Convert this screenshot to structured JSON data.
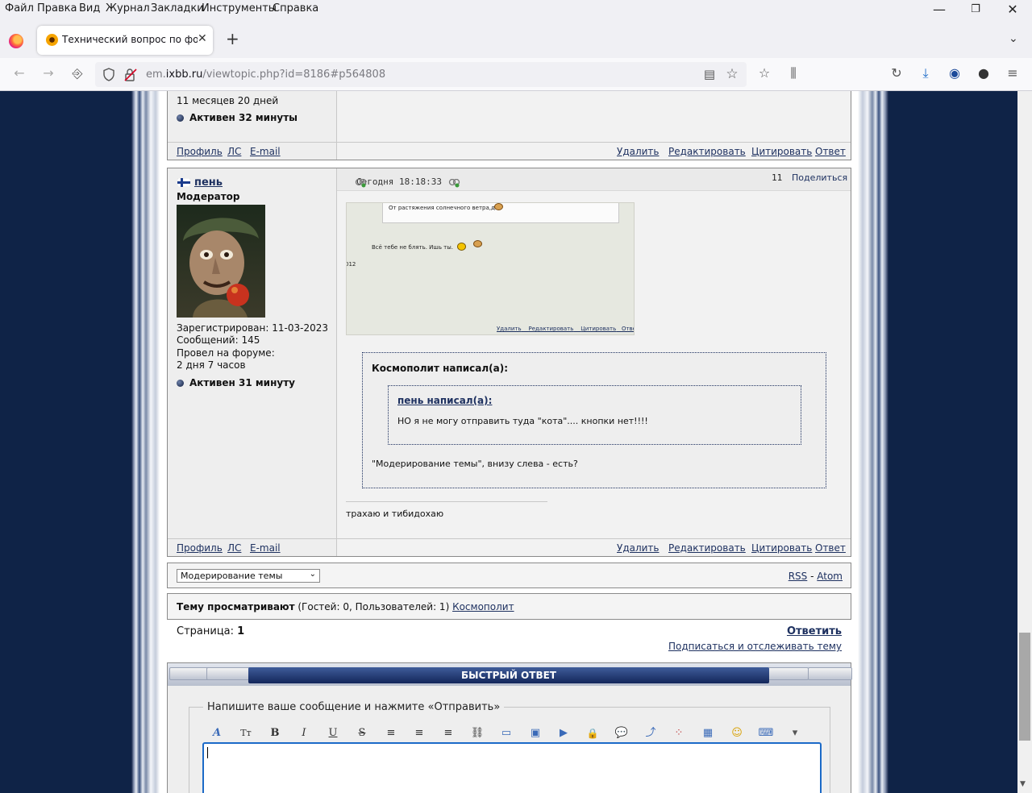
{
  "menubar": {
    "items": [
      "Файл",
      "Правка",
      "Вид",
      "Журнал",
      "Закладки",
      "Инструменты",
      "Справка"
    ],
    "minimize": "—",
    "restore": "❐",
    "close": "✕"
  },
  "tab": {
    "title": "Технический вопрос по форуму",
    "close": "✕",
    "new_tab": "+",
    "list": "⌄"
  },
  "nav": {
    "back": "←",
    "forward": "→",
    "import": "⎆",
    "url_prefix": "em.",
    "url_domain": "ixbb.ru",
    "url_path": "/viewtopic.php?id=8186#p564808",
    "reader": "▤",
    "star": "☆",
    "icons": [
      "☆",
      "⫼",
      "↻",
      "⤓",
      "◉",
      "●",
      "≡"
    ]
  },
  "prev_post": {
    "time_on_forum": "11 месяцев 20 дней",
    "active": "Активен 32 минуты",
    "links_left": [
      "Профиль",
      "ЛС",
      "E-mail"
    ],
    "links_right": [
      "Удалить",
      "Редактировать",
      "Цитировать",
      "Ответ"
    ]
  },
  "post": {
    "author": "пень",
    "role": "Модератор",
    "time": "Сегодня 18:18:33",
    "number": "11",
    "share": "Поделиться",
    "registered": "Зарегистрирован: 11-03-2023",
    "messages": "Сообщений: 145",
    "time_on_forum_label": "Провел на форуме:",
    "time_on_forum": "2 дня 7 часов",
    "active": "Активен 31 минуту",
    "screenshot": {
      "line1": "От растяжения солнечного ветра,да",
      "line2": "Всё тебе не  блять.  Ишь ты.",
      "side_num": "012",
      "links": [
        "Удалить",
        "Редактировать",
        "Цитировать",
        "Ответ"
      ]
    },
    "quote_outer": {
      "author_line": "Космополит написал(а):",
      "inner_author": "пень написал(а):",
      "inner_text": "НО я не могу отправить туда \"кота\".... кнопки нет!!!!",
      "text": "\"Модерирование темы\", внизу слева - есть?"
    },
    "signature": "трахаю и тибидохаю",
    "links_left": [
      "Профиль",
      "ЛС",
      "E-mail"
    ],
    "links_right": [
      "Удалить",
      "Редактировать",
      "Цитировать",
      "Ответ"
    ]
  },
  "moderation": {
    "select_value": "Модерирование темы",
    "rss": "RSS",
    "dash": " - ",
    "atom": "Atom"
  },
  "viewers": {
    "label": "Тему просматривают",
    "counts": " (Гостей: 0, Пользователей: 1) ",
    "user": "Космополит"
  },
  "pages": {
    "label": "Страница: ",
    "number": "1",
    "reply": "Ответить",
    "subscribe": "Подписаться и отслеживать тему"
  },
  "quick_reply": {
    "title": "БЫСТРЫЙ ОТВЕТ",
    "legend": "Напишите ваше сообщение и нажмите «Отправить»",
    "toolbar": [
      "A",
      "Tт",
      "B",
      "I",
      "U",
      "S",
      "≡",
      "≡",
      "≡",
      "⛓",
      "▭",
      "▣",
      "▶",
      "🔒",
      "💬",
      "⤴",
      "⁘",
      "▦",
      "☺",
      "⌨",
      "▾"
    ]
  },
  "colors": {
    "link": "#1e3160",
    "page_bg": "#0f2347",
    "header_bar": "#13265a"
  }
}
